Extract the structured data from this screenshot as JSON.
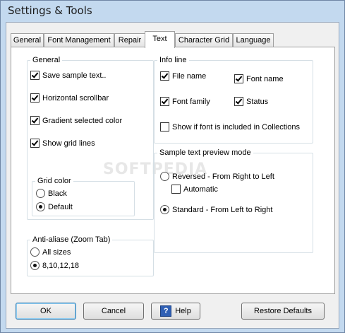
{
  "window": {
    "title": "Settings & Tools"
  },
  "tabs": [
    {
      "label": "General"
    },
    {
      "label": "Font Management"
    },
    {
      "label": "Repair"
    },
    {
      "label": "Text",
      "active": true
    },
    {
      "label": "Character Grid"
    },
    {
      "label": "Language"
    }
  ],
  "general": {
    "legend": "General",
    "save_sample_text": {
      "label": "Save sample text..",
      "checked": true
    },
    "horizontal_scrollbar": {
      "label": "Horizontal scrollbar",
      "checked": true
    },
    "gradient_selected_color": {
      "label": "Gradient selected color",
      "checked": true
    },
    "show_grid_lines": {
      "label": "Show grid lines",
      "checked": true
    },
    "grid_color": {
      "legend": "Grid color",
      "black": {
        "label": "Black",
        "selected": false
      },
      "default": {
        "label": "Default",
        "selected": true
      }
    }
  },
  "anti_alias": {
    "legend": "Anti-aliase (Zoom Tab)",
    "all_sizes": {
      "label": "All sizes",
      "selected": false
    },
    "sizes": {
      "label": "8,10,12,18",
      "selected": true
    }
  },
  "info_line": {
    "legend": "Info line",
    "file_name": {
      "label": "File name",
      "checked": true
    },
    "font_name": {
      "label": "Font name",
      "checked": true
    },
    "font_family": {
      "label": "Font family",
      "checked": true
    },
    "status": {
      "label": "Status",
      "checked": true
    },
    "show_in_collections": {
      "label": "Show if font is included in Collections",
      "checked": false
    }
  },
  "preview_mode": {
    "legend": "Sample text preview mode",
    "reversed": {
      "label": "Reversed - From Right to Left",
      "selected": false
    },
    "automatic": {
      "label": "Automatic",
      "checked": false
    },
    "standard": {
      "label": "Standard - From Left to Right",
      "selected": true
    }
  },
  "watermark": "SOFTPEDIA",
  "buttons": {
    "ok": "OK",
    "cancel": "Cancel",
    "help": "Help",
    "restore_defaults": "Restore Defaults"
  }
}
